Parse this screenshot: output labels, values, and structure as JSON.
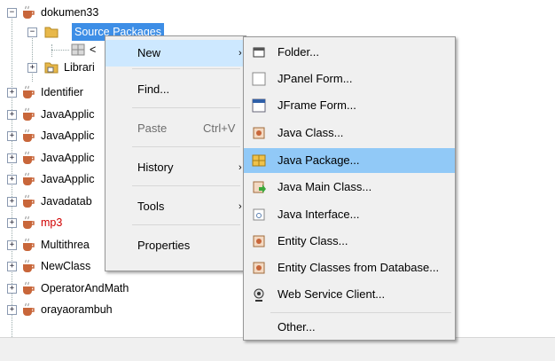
{
  "tree": {
    "items": [
      {
        "label": "dokumen33",
        "color": "#000000"
      },
      {
        "label": "Source Packages"
      },
      {
        "label": "<"
      },
      {
        "label": "Librari"
      },
      {
        "label": "Identifier",
        "color": "#000000"
      },
      {
        "label": "JavaApplic",
        "color": "#000000"
      },
      {
        "label": "JavaApplic",
        "color": "#000000"
      },
      {
        "label": "JavaApplic",
        "color": "#000000"
      },
      {
        "label": "JavaApplic",
        "color": "#000000"
      },
      {
        "label": "Javadatab",
        "color": "#000000"
      },
      {
        "label": "mp3",
        "color": "#d00000"
      },
      {
        "label": "Multithrea",
        "color": "#000000"
      },
      {
        "label": "NewClass",
        "color": "#000000"
      },
      {
        "label": "OperatorAndMath",
        "color": "#000000"
      },
      {
        "label": "orayaorambuh",
        "color": "#000000"
      }
    ]
  },
  "context_menu": {
    "new": "New",
    "find": "Find...",
    "paste": "Paste",
    "paste_shortcut": "Ctrl+V",
    "history": "History",
    "tools": "Tools",
    "properties": "Properties",
    "submenu_arrow": "›"
  },
  "submenu": {
    "items": [
      {
        "label": "Folder...",
        "icon": "folder-icon"
      },
      {
        "label": "JPanel Form...",
        "icon": "jpanel-form-icon"
      },
      {
        "label": "JFrame Form...",
        "icon": "jframe-form-icon"
      },
      {
        "label": "Java Class...",
        "icon": "java-class-icon"
      },
      {
        "label": "Java Package...",
        "icon": "java-package-icon"
      },
      {
        "label": "Java Main Class...",
        "icon": "java-main-class-icon"
      },
      {
        "label": "Java Interface...",
        "icon": "java-interface-icon"
      },
      {
        "label": "Entity Class...",
        "icon": "entity-class-icon"
      },
      {
        "label": "Entity Classes from Database...",
        "icon": "entity-classes-db-icon"
      },
      {
        "label": "Web Service Client...",
        "icon": "web-service-client-icon"
      },
      {
        "label": "Other..."
      }
    ]
  },
  "colors": {
    "selection": "#3d8ee6",
    "menu_background": "#f0f0f0",
    "submenu_highlight": "#91c9f7",
    "error_text": "#d00000"
  }
}
